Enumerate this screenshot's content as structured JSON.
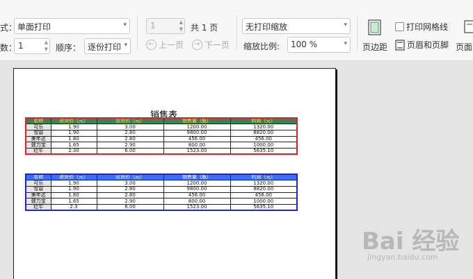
{
  "toolbar": {
    "print_mode_label_fragment": "式：",
    "print_mode_value": "单面打印",
    "copies_label_fragment": "数：",
    "copies_value": "1",
    "order_label": "顺序：",
    "order_value": "逐份打印",
    "page_value": "1",
    "total_pages": "共 1 页",
    "prev_page": "上一页",
    "next_page": "下一页",
    "scaling_value": "无打印缩放",
    "zoom_label": "缩放比例:",
    "zoom_value": "100 %",
    "margins_label": "页边距",
    "gridlines_label": "打印网格线",
    "header_footer_label": "页眉和页脚",
    "page_setup_fragment": "页面"
  },
  "sheet": {
    "title": "销售表",
    "headers": [
      "名称",
      "进货价（元）",
      "出货价（元）",
      "销售量（瓶）",
      "利润（元）"
    ],
    "table1_rows": [
      [
        "可乐",
        "1.90",
        "3.00",
        "1200.00",
        "1320.00"
      ],
      [
        "雪碧",
        "1.90",
        "2.80",
        "9800.00",
        "8820.00"
      ],
      [
        "美年达",
        "1.80",
        "2.80",
        "456.00",
        "456.00"
      ],
      [
        "健力宝",
        "1.65",
        "2.90",
        "800.00",
        "1000.00"
      ],
      [
        "红牛",
        "2.30",
        "6.00",
        "1523.00",
        "5635.10"
      ]
    ],
    "table2_rows": [
      [
        "可乐",
        "1.90",
        "3.00",
        "1200.00",
        "1320.00"
      ],
      [
        "雪碧",
        "1.90",
        "2.80",
        "9800.00",
        "8820.00"
      ],
      [
        "美年达",
        "1.80",
        "2.80",
        "456.00",
        "456.00"
      ],
      [
        "健力宝",
        "1.65",
        "2.90",
        "800.00",
        "1000.00"
      ],
      [
        "红牛",
        "2.3",
        "6.00",
        "1523.00",
        "5635.10"
      ]
    ],
    "table1_border_color": "#e02020",
    "table1_header_bg": "#2e8b57",
    "table2_border_color": "#2020e0",
    "table2_header_bg": "#3d6ff2"
  },
  "watermark": {
    "brand": "Bai 经验",
    "url": "jingyan.baidu.com"
  }
}
